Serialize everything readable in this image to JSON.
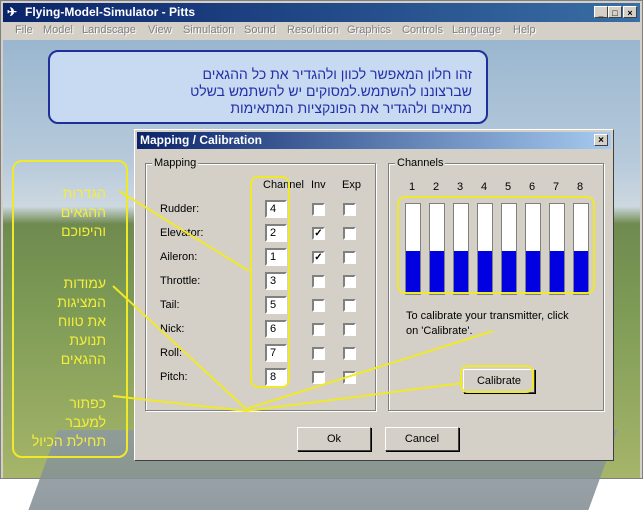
{
  "window": {
    "title": "Flying-Model-Simulator - Pitts"
  },
  "menu": [
    "File",
    "Model",
    "Landscape",
    "View",
    "Simulation",
    "Sound",
    "Resolution",
    "Graphics",
    "Controls",
    "Language",
    "Help"
  ],
  "annotation_top": {
    "lines": [
      "זהו חלון המאפשר לכוון ולהגדיר את כל ההגאים",
      "שברצוננו להשתמש.למסוקים יש להשתמש בשלט",
      "מתאים ולהגדיר את הפונקציות המתאימות"
    ]
  },
  "dialog": {
    "title": "Mapping / Calibration",
    "close": "×",
    "mapping": {
      "group_label": "Mapping",
      "col_channel": "Channel",
      "col_inv": "Inv",
      "col_exp": "Exp",
      "rows": [
        {
          "name": "Rudder:",
          "channel": "4",
          "inv": false,
          "exp": false
        },
        {
          "name": "Elevator:",
          "channel": "2",
          "inv": true,
          "exp": false
        },
        {
          "name": "Aileron:",
          "channel": "1",
          "inv": true,
          "exp": false
        },
        {
          "name": "Throttle:",
          "channel": "3",
          "inv": false,
          "exp": false
        },
        {
          "name": "Tail:",
          "channel": "5",
          "inv": false,
          "exp": false
        },
        {
          "name": "Nick:",
          "channel": "6",
          "inv": false,
          "exp": false
        },
        {
          "name": "Roll:",
          "channel": "7",
          "inv": false,
          "exp": false
        },
        {
          "name": "Pitch:",
          "channel": "8",
          "inv": false,
          "exp": false
        }
      ]
    },
    "channels": {
      "group_label": "Channels",
      "numbers": [
        "1",
        "2",
        "3",
        "4",
        "5",
        "6",
        "7",
        "8"
      ],
      "fill_fraction": [
        0.48,
        0.48,
        0.48,
        0.48,
        0.48,
        0.48,
        0.48,
        0.48
      ],
      "fill_color": "#0000e0",
      "help_line1": "To calibrate your transmitter, click",
      "help_line2": "on 'Calibrate'.",
      "calibrate_label": "Calibrate"
    },
    "ok_label": "Ok",
    "cancel_label": "Cancel"
  },
  "side_annotations": [
    [
      "הגדרות",
      "ההגאים",
      "והיפוכם"
    ],
    [
      "עמודות",
      "המציגות",
      "את טווח",
      "תנועת",
      "ההגאים"
    ],
    [
      "כפתור",
      "למעבר",
      "תחילת הכיול"
    ]
  ],
  "annotation_color": "#f0e92a"
}
